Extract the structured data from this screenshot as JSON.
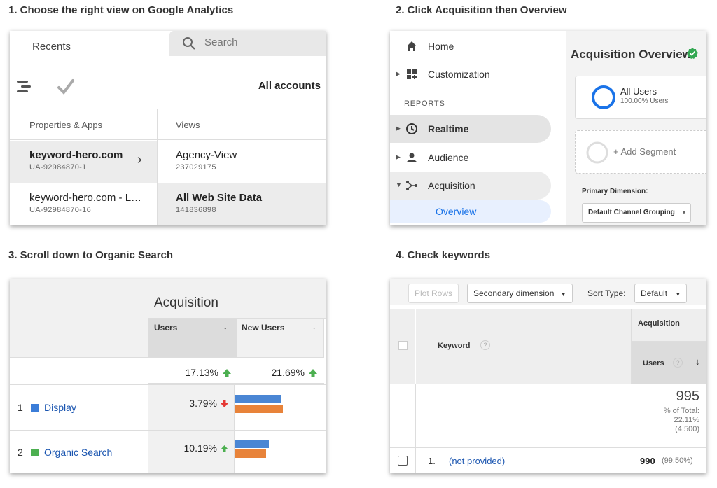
{
  "steps": {
    "s1": "1. Choose the right view on Google Analytics",
    "s2": "2. Click Acquisition then Overview",
    "s3": "3. Scroll down to Organic Search",
    "s4": "4. Check keywords"
  },
  "panel1": {
    "tab_recents": "Recents",
    "search_placeholder": "Search",
    "all_accounts": "All accounts",
    "col_properties": "Properties & Apps",
    "col_views": "Views",
    "properties": [
      {
        "name": "keyword-hero.com",
        "id": "UA-92984870-1"
      },
      {
        "name": "keyword-hero.com - L…",
        "id": "UA-92984870-16"
      }
    ],
    "views": [
      {
        "name": "Agency-View",
        "id": "237029175"
      },
      {
        "name": "All Web Site Data",
        "id": "141836898"
      }
    ],
    "chevron": "›"
  },
  "panel2": {
    "nav": {
      "home": "Home",
      "customization": "Customization",
      "reports_heading": "REPORTS",
      "realtime": "Realtime",
      "audience": "Audience",
      "acquisition": "Acquisition",
      "overview": "Overview"
    },
    "title": "Acquisition Overview",
    "segment_name": "All Users",
    "segment_pct": "100.00% Users",
    "add_segment": "+ Add Segment",
    "primary_dimension_label": "Primary Dimension:",
    "primary_dimension_value": "Default Channel Grouping"
  },
  "panel3": {
    "group_header": "Acquisition",
    "col_users": "Users",
    "col_new_users": "New Users",
    "sort_icon": "↓",
    "total_users": "17.13%",
    "total_new_users": "21.69%",
    "rows": [
      {
        "num": "1",
        "channel": "Display",
        "color": "#3b7dd8",
        "change": "3.79%",
        "trend": "down",
        "bar_blue": 0.54,
        "bar_orange": 0.56
      },
      {
        "num": "2",
        "channel": "Organic Search",
        "color": "#4caf50",
        "change": "10.19%",
        "trend": "up",
        "bar_blue": 0.39,
        "bar_orange": 0.36
      }
    ]
  },
  "panel4": {
    "plot_rows": "Plot Rows",
    "secondary_dimension": "Secondary dimension",
    "sort_type_label": "Sort Type:",
    "sort_type_value": "Default",
    "col_keyword": "Keyword",
    "col_group": "Acquisition",
    "col_users": "Users",
    "total_value": "995",
    "total_pct_label": "% of Total:",
    "total_pct": "22.11%",
    "total_abs": "(4,500)",
    "row_num": "1.",
    "row_keyword": "(not provided)",
    "row_users": "990",
    "row_pct": "(99.50%)",
    "help": "?"
  }
}
